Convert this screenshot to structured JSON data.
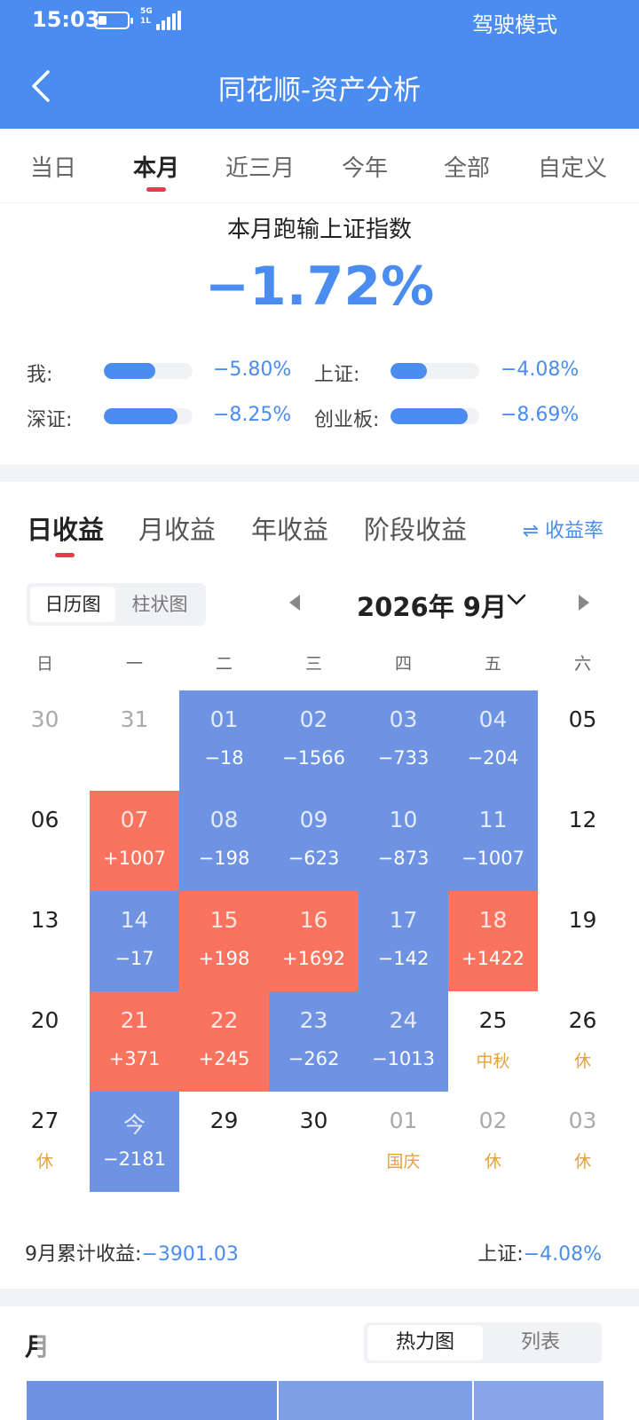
{
  "status_bar": {
    "time": "15:03",
    "network": "5G",
    "network_sub": "1L",
    "mode": "驾驶模式"
  },
  "nav": {
    "title": "同花顺-资产分析"
  },
  "period_tabs": [
    {
      "label": "当日",
      "active": false
    },
    {
      "label": "本月",
      "active": true
    },
    {
      "label": "近三月",
      "active": false
    },
    {
      "label": "今年",
      "active": false
    },
    {
      "label": "全部",
      "active": false
    },
    {
      "label": "自定义",
      "active": false
    }
  ],
  "summary": {
    "title": "本月跑输上证指数",
    "value": "−1.72%",
    "comparisons": [
      {
        "label": "我:",
        "value": "−5.80%",
        "bar_fraction": 0.58
      },
      {
        "label": "上证:",
        "value": "−4.08%",
        "bar_fraction": 0.41
      },
      {
        "label": "深证:",
        "value": "−8.25%",
        "bar_fraction": 0.83
      },
      {
        "label": "创业板:",
        "value": "−8.69%",
        "bar_fraction": 0.87
      }
    ]
  },
  "income_tabs": [
    {
      "label": "日收益",
      "active": true
    },
    {
      "label": "月收益",
      "active": false
    },
    {
      "label": "年收益",
      "active": false
    },
    {
      "label": "阶段收益",
      "active": false
    }
  ],
  "rate_link": "⇌ 收益率",
  "view_toggle": {
    "calendar": "日历图",
    "bar": "柱状图",
    "active": "calendar"
  },
  "month": {
    "label": "2026年 9月"
  },
  "weekdays": [
    "日",
    "一",
    "二",
    "三",
    "四",
    "五",
    "六"
  ],
  "calendar": [
    {
      "day": "30",
      "sub": "",
      "state": "muted"
    },
    {
      "day": "31",
      "sub": "",
      "state": "muted"
    },
    {
      "day": "01",
      "sub": "−18",
      "state": "loss"
    },
    {
      "day": "02",
      "sub": "−1566",
      "state": "loss"
    },
    {
      "day": "03",
      "sub": "−733",
      "state": "loss"
    },
    {
      "day": "04",
      "sub": "−204",
      "state": "loss"
    },
    {
      "day": "05",
      "sub": "",
      "state": "normal"
    },
    {
      "day": "06",
      "sub": "",
      "state": "normal"
    },
    {
      "day": "07",
      "sub": "+1007",
      "state": "gain"
    },
    {
      "day": "08",
      "sub": "−198",
      "state": "loss"
    },
    {
      "day": "09",
      "sub": "−623",
      "state": "loss"
    },
    {
      "day": "10",
      "sub": "−873",
      "state": "loss"
    },
    {
      "day": "11",
      "sub": "−1007",
      "state": "loss"
    },
    {
      "day": "12",
      "sub": "",
      "state": "normal"
    },
    {
      "day": "13",
      "sub": "",
      "state": "normal"
    },
    {
      "day": "14",
      "sub": "−17",
      "state": "loss"
    },
    {
      "day": "15",
      "sub": "+198",
      "state": "gain"
    },
    {
      "day": "16",
      "sub": "+1692",
      "state": "gain"
    },
    {
      "day": "17",
      "sub": "−142",
      "state": "loss"
    },
    {
      "day": "18",
      "sub": "+1422",
      "state": "gain"
    },
    {
      "day": "19",
      "sub": "",
      "state": "normal"
    },
    {
      "day": "20",
      "sub": "",
      "state": "normal"
    },
    {
      "day": "21",
      "sub": "+371",
      "state": "gain"
    },
    {
      "day": "22",
      "sub": "+245",
      "state": "gain"
    },
    {
      "day": "23",
      "sub": "−262",
      "state": "loss"
    },
    {
      "day": "24",
      "sub": "−1013",
      "state": "loss"
    },
    {
      "day": "25",
      "sub": "中秋",
      "state": "holiday"
    },
    {
      "day": "26",
      "sub": "休",
      "state": "holiday"
    },
    {
      "day": "27",
      "sub": "休",
      "state": "holiday"
    },
    {
      "day": "今",
      "sub": "−2181",
      "state": "loss"
    },
    {
      "day": "29",
      "sub": "",
      "state": "normal"
    },
    {
      "day": "30",
      "sub": "",
      "state": "normal"
    },
    {
      "day": "01",
      "sub": "国庆",
      "state": "muted-holiday"
    },
    {
      "day": "02",
      "sub": "休",
      "state": "muted-holiday"
    },
    {
      "day": "03",
      "sub": "休",
      "state": "muted-holiday"
    }
  ],
  "totals": {
    "label": "9月累计收益:",
    "value": "−3901.03",
    "index_label": "上证:",
    "index_value": "−4.08%"
  },
  "bottom": {
    "title": "月",
    "heatmap_label": "热力图",
    "list_label": "列表"
  },
  "colors": {
    "brand_blue": "#4a8cf0",
    "loss_cell": "#6f93e3",
    "gain_cell": "#fa735e",
    "holiday_text": "#e4a23a",
    "tab_indicator": "#e93a4e"
  }
}
